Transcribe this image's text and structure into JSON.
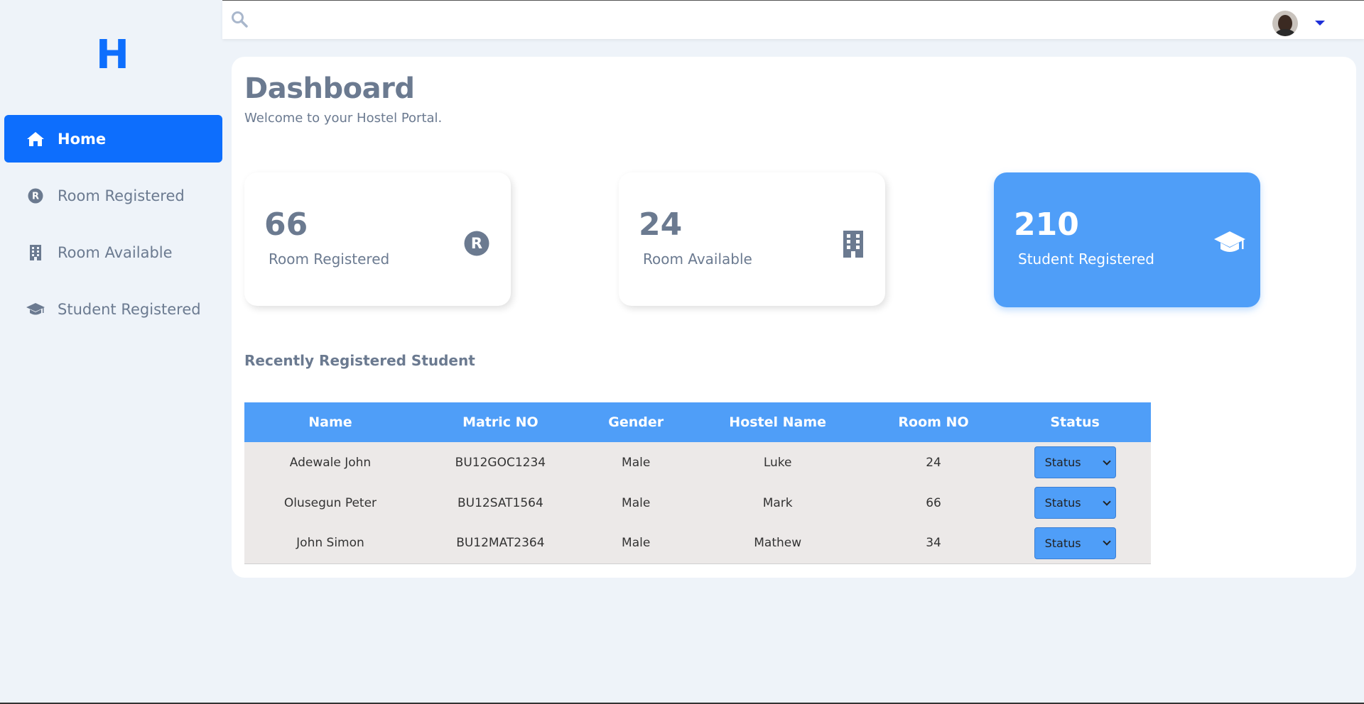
{
  "sidebar": {
    "logo": "H",
    "items": [
      {
        "label": "Home",
        "icon": "home-icon",
        "active": true
      },
      {
        "label": "Room Registered",
        "icon": "registered-icon",
        "active": false
      },
      {
        "label": "Room Available",
        "icon": "building-icon",
        "active": false
      },
      {
        "label": "Student Registered",
        "icon": "graduation-cap-icon",
        "active": false
      }
    ]
  },
  "topbar": {
    "search_icon": "search-icon",
    "avatar_icon": "user-avatar",
    "menu_icon": "caret-down-icon"
  },
  "main": {
    "title": "Dashboard",
    "subtitle": "Welcome to your Hostel Portal.",
    "cards": [
      {
        "value": "66",
        "label": "Room Registered",
        "icon": "registered-icon"
      },
      {
        "value": "24",
        "label": "Room Available",
        "icon": "building-icon"
      },
      {
        "value": "210",
        "label": "Student Registered",
        "icon": "graduation-cap-icon"
      }
    ],
    "section_title": "Recently Registered Student",
    "table": {
      "columns": [
        "Name",
        "Matric NO",
        "Gender",
        "Hostel Name",
        "Room NO",
        "Status"
      ],
      "rows": [
        {
          "name": "Adewale John",
          "matric": "BU12GOC1234",
          "gender": "Male",
          "hostel": "Luke",
          "room": "24",
          "status": "Status"
        },
        {
          "name": "Olusegun Peter",
          "matric": "BU12SAT1564",
          "gender": "Male",
          "hostel": "Mark",
          "room": "66",
          "status": "Status"
        },
        {
          "name": "John Simon",
          "matric": "BU12MAT2364",
          "gender": "Male",
          "hostel": "Mathew",
          "room": "34",
          "status": "Status"
        }
      ]
    }
  },
  "colors": {
    "primary": "#0d6efd",
    "card_highlight": "#4f9ef8",
    "text_muted": "#6b7a90",
    "background": "#eef3f9",
    "table_row_bg": "#ece9e8"
  }
}
